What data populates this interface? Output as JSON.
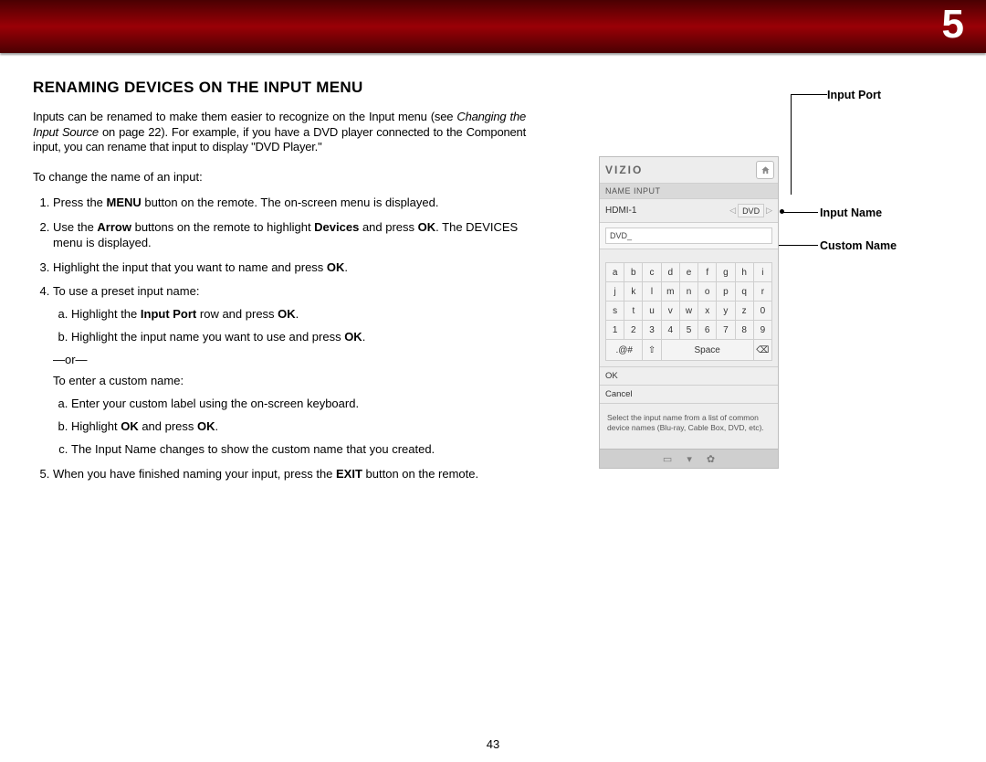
{
  "chapter_number": "5",
  "page_number": "43",
  "heading": "RENAMING DEVICES ON THE INPUT MENU",
  "intro_p1_a": "Inputs can be renamed to make them easier to recognize  on the Input menu (see ",
  "intro_p1_i": "Changing the Input Source",
  "intro_p1_b": " on page 22). For example, if you have a DVD player connected to the Component input, you can rename that input to display \"DVD Player.\"",
  "lead": "To change the name of an input:",
  "step1_a": "Press the ",
  "step1_b": "MENU",
  "step1_c": " button on the remote. The on-screen menu is displayed.",
  "step2_a": "Use the ",
  "step2_b": "Arrow",
  "step2_c": " buttons on the remote to highlight ",
  "step2_d": "Devices",
  "step2_e": " and press ",
  "step2_f": "OK",
  "step2_g": ". The DEVICES menu is displayed.",
  "step3_a": "Highlight the input that you want to name and press ",
  "step3_b": "OK",
  "step3_c": ".",
  "step4": "To use a preset input name:",
  "step4a_a": "Highlight the ",
  "step4a_b": "Input Port",
  "step4a_c": " row and press ",
  "step4a_d": "OK",
  "step4a_e": ".",
  "step4b_a": "Highlight the input name you want to use and press ",
  "step4b_b": "OK",
  "step4b_c": ".",
  "or": "—or—",
  "customlead": "To enter a custom name:",
  "step4c": "Enter your custom label using the on-screen keyboard.",
  "step4d_a": "Highlight ",
  "step4d_b": "OK",
  "step4d_c": " and press ",
  "step4d_d": "OK",
  "step4d_e": ".",
  "step4e": "The Input Name changes to show the custom name that you created.",
  "step5_a": "When you have finished naming your input, press the ",
  "step5_b": "EXIT",
  "step5_c": " button on the remote.",
  "callout_port": "Input Port",
  "callout_name": "Input Name",
  "callout_custom": "Custom Name",
  "osd": {
    "brand": "VIZIO",
    "crumb": "NAME INPUT",
    "port_label": "HDMI-1",
    "port_value": "DVD",
    "custom_value": "DVD_",
    "help": "Select the input name from a list of common device names (Blu-ray, Cable Box, DVD, etc).",
    "ok": "OK",
    "cancel": "Cancel",
    "keys_r1": [
      "a",
      "b",
      "c",
      "d",
      "e",
      "f",
      "g",
      "h",
      "i"
    ],
    "keys_r2": [
      "j",
      "k",
      "l",
      "m",
      "n",
      "o",
      "p",
      "q",
      "r"
    ],
    "keys_r3": [
      "s",
      "t",
      "u",
      "v",
      "w",
      "x",
      "y",
      "z",
      "0"
    ],
    "keys_r4": [
      "1",
      "2",
      "3",
      "4",
      "5",
      "6",
      "7",
      "8",
      "9"
    ],
    "sym": ".@#",
    "space": "Space"
  }
}
